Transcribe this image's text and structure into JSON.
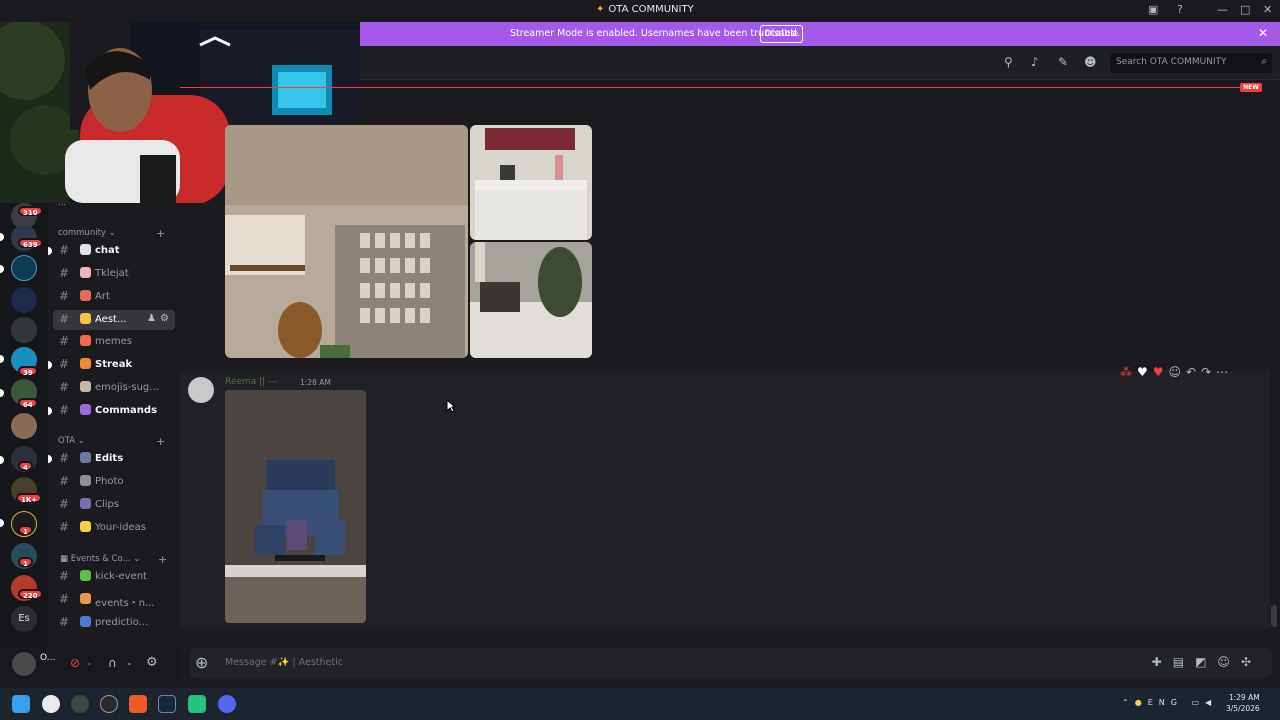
{
  "window": {
    "title": "OTA COMMUNITY",
    "icons": [
      "inbox-icon",
      "help-icon",
      "minimize-icon",
      "maximize-icon",
      "close-icon"
    ]
  },
  "banner": {
    "message": "Streamer Mode is enabled. Usernames have been truncated.",
    "disable_label": "Disable"
  },
  "header": {
    "search_placeholder": "Search OTA COMMUNITY",
    "new_badge": "NEW"
  },
  "servers": {
    "badges": [
      "310",
      "639",
      "39",
      "64",
      "4",
      "1K+",
      "1",
      "1",
      "220"
    ],
    "text_server": "Es"
  },
  "channels": {
    "partial_top": "...",
    "categories": [
      {
        "label": "community",
        "channels": [
          {
            "name": "chat",
            "unread": true
          },
          {
            "name": "Tklejat",
            "unread": false
          },
          {
            "name": "Art",
            "unread": false
          },
          {
            "name": "Aest...",
            "unread": false,
            "active": true
          },
          {
            "name": "memes",
            "unread": false
          },
          {
            "name": "Streak",
            "unread": true
          },
          {
            "name": "emojis-sug...",
            "unread": false
          },
          {
            "name": "Commands",
            "unread": true
          }
        ]
      },
      {
        "label": "OTA",
        "channels": [
          {
            "name": "Edits",
            "unread": true
          },
          {
            "name": "Photo",
            "unread": false
          },
          {
            "name": "Clips",
            "unread": false
          },
          {
            "name": "Your-ideas",
            "unread": false
          }
        ]
      },
      {
        "label": "Events & Co...",
        "channels": [
          {
            "name": "kick-event",
            "unread": false
          },
          {
            "name": "events・n...",
            "unread": false
          },
          {
            "name": "predictio...",
            "unread": false
          }
        ]
      }
    ]
  },
  "user_panel": {
    "name": "O..."
  },
  "message": {
    "author": "Reema || ---",
    "time": "1:28 AM"
  },
  "composer": {
    "placeholder": "Message #✨ | Aesthetic"
  },
  "taskbar": {
    "language": "ENG",
    "time": "1:29 AM",
    "date": "3/5/2026"
  },
  "colors": {
    "accent": "#a35ae8",
    "new_line": "#f23f43",
    "background": "#1b1b1f"
  }
}
